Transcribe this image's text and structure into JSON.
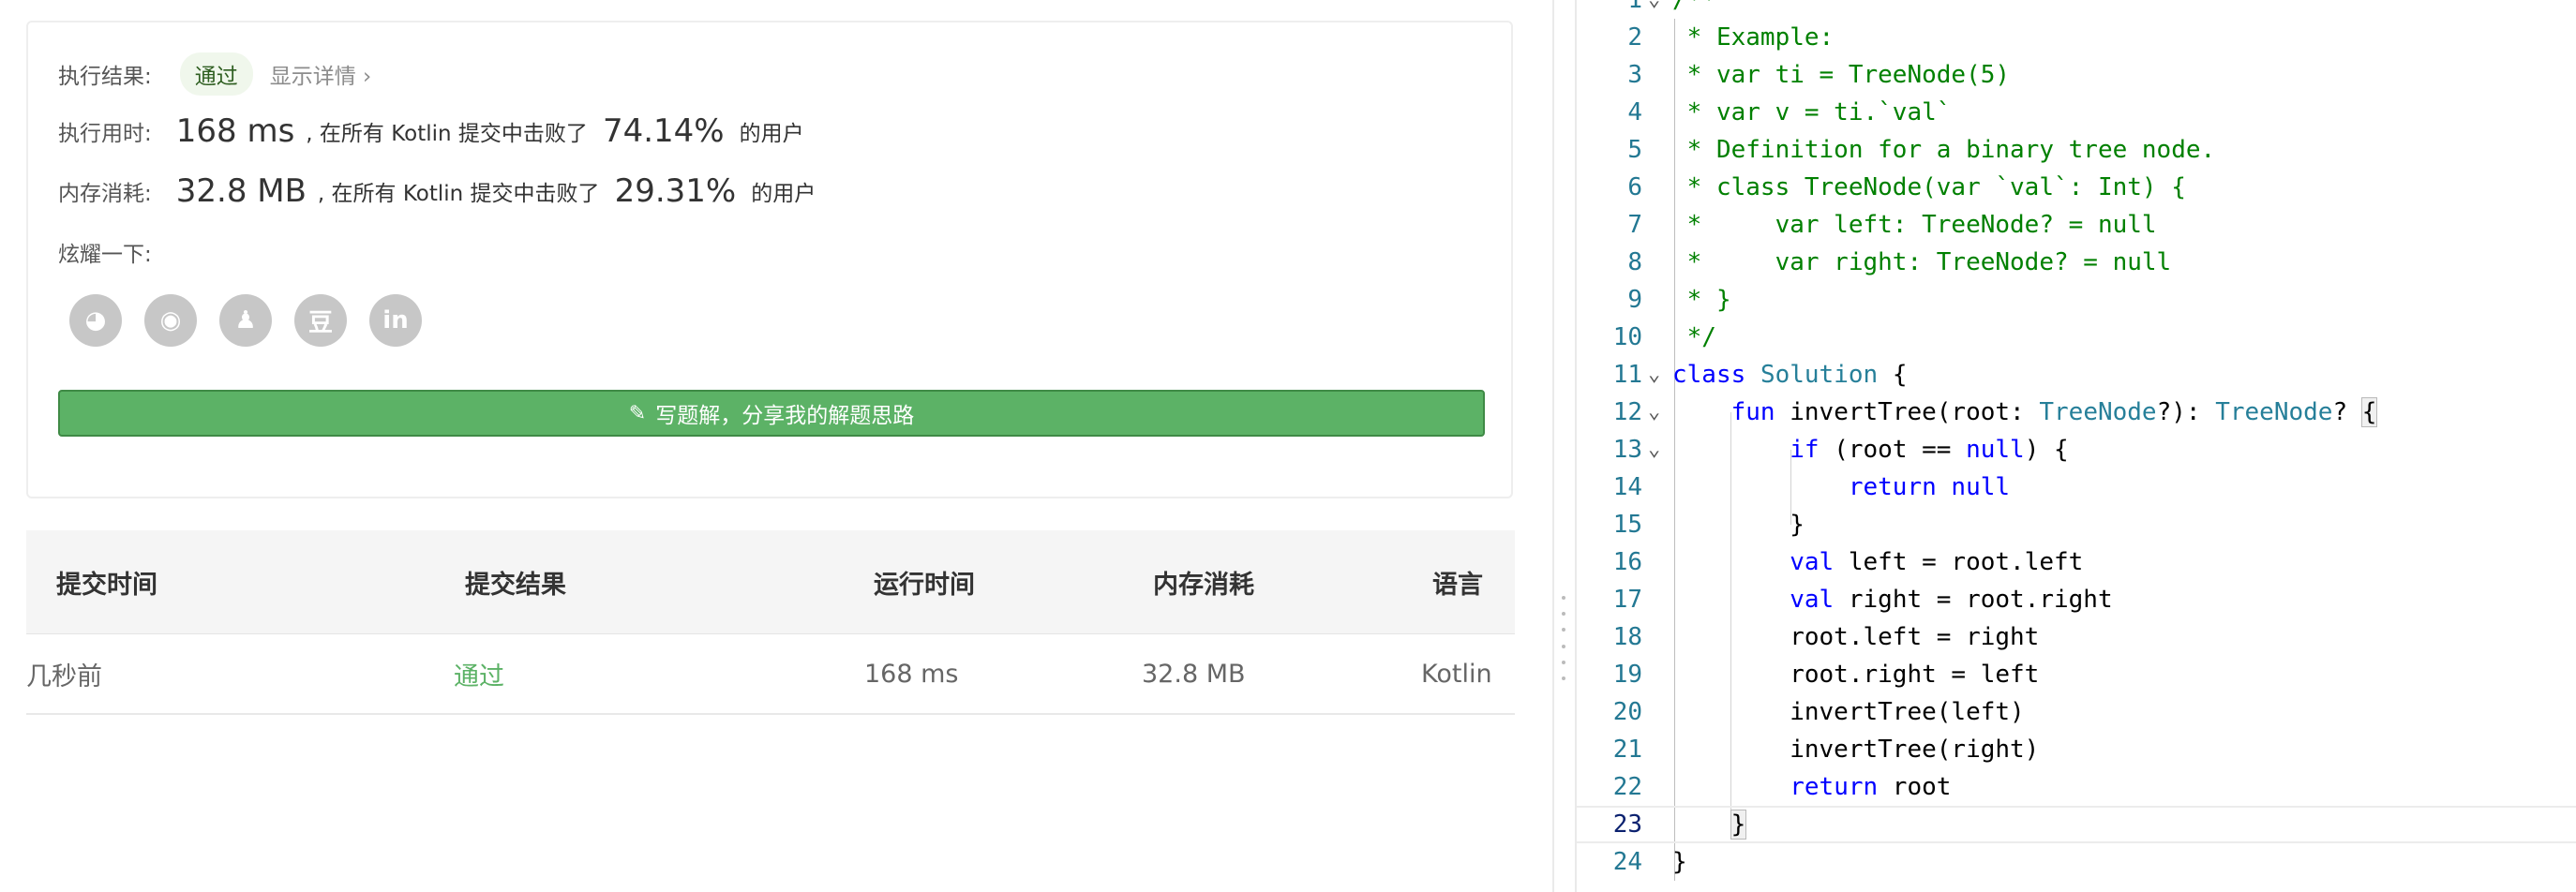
{
  "result": {
    "status_label": "执行结果:",
    "status_value": "通过",
    "details_link": "显示详情 ›",
    "runtime_label": "执行用时:",
    "runtime_value": "168 ms",
    "runtime_text": ", 在所有 Kotlin 提交中击败了",
    "runtime_pct": "74.14%",
    "runtime_suffix": "的用户",
    "memory_label": "内存消耗:",
    "memory_value": "32.8 MB",
    "memory_text": ", 在所有 Kotlin 提交中击败了",
    "memory_pct": "29.31%",
    "memory_suffix": "的用户",
    "share_label": "炫耀一下:",
    "share_icons": [
      {
        "icon": "wechat-icon",
        "glyph": "◕"
      },
      {
        "icon": "weibo-icon",
        "glyph": "◉"
      },
      {
        "icon": "qq-icon",
        "glyph": "♟"
      },
      {
        "icon": "douban-icon",
        "glyph": "豆"
      },
      {
        "icon": "linkedin-icon",
        "glyph": "in"
      }
    ],
    "write_solution_label": "写题解，分享我的解题思路"
  },
  "submissions": {
    "headers": [
      "提交时间",
      "提交结果",
      "运行时间",
      "内存消耗",
      "语言"
    ],
    "rows": [
      [
        "几秒前",
        "通过",
        "168 ms",
        "32.8 MB",
        "Kotlin"
      ]
    ]
  },
  "editor": {
    "lines": [
      "/**",
      " * Example:",
      " * var ti = TreeNode(5)",
      " * var v = ti.`val`",
      " * Definition for a binary tree node.",
      " * class TreeNode(var `val`: Int) {",
      " *     var left: TreeNode? = null",
      " *     var right: TreeNode? = null",
      " * }",
      " */",
      "class Solution {",
      "    fun invertTree(root: TreeNode?): TreeNode? {",
      "        if (root == null) {",
      "            return null",
      "        }",
      "        val left = root.left",
      "        val right = root.right",
      "        root.left = right",
      "        root.right = left",
      "        invertTree(left)",
      "        invertTree(right)",
      "        return root",
      "    }",
      "}"
    ],
    "active_line": 23,
    "colors": {
      "keyword": "#0000ff",
      "type": "#267f99",
      "comment": "#008000",
      "line_number": "#237893"
    }
  },
  "colors": {
    "accent_green": "#5cb266",
    "badge_bg": "#f0f7ec"
  }
}
